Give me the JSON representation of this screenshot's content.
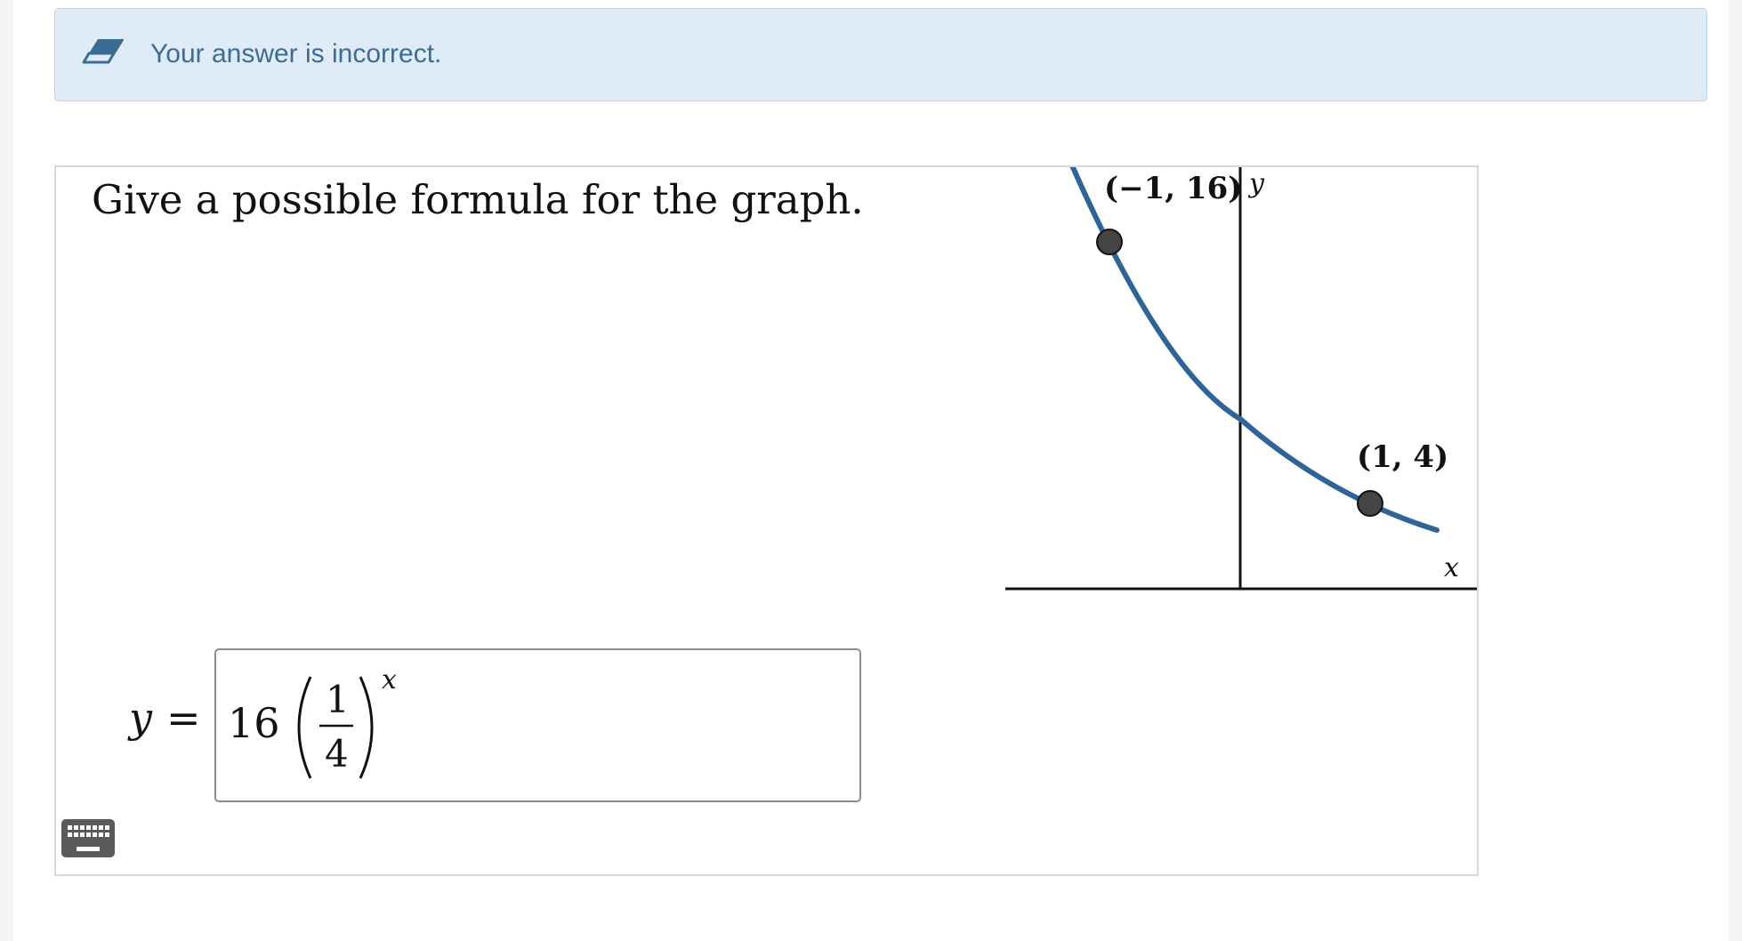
{
  "feedback": {
    "message": "Your answer is incorrect.",
    "icon": "eraser-icon",
    "background_color": "#dfecf7",
    "text_color": "#3b6d92"
  },
  "problem": {
    "prompt": "Give a possible formula for the graph.",
    "graph": {
      "curve_color": "#2f6496",
      "x_axis_label": "x",
      "y_axis_label": "y",
      "points": [
        {
          "label": "(−1, 16)",
          "x": -1,
          "y": 16
        },
        {
          "label": "(1, 4)",
          "x": 1,
          "y": 4
        }
      ]
    },
    "answer": {
      "lhs": "y",
      "equals": "=",
      "coefficient": "16",
      "numerator": "1",
      "denominator": "4",
      "exponent": "x"
    },
    "keyboard_icon": "keyboard-icon"
  }
}
